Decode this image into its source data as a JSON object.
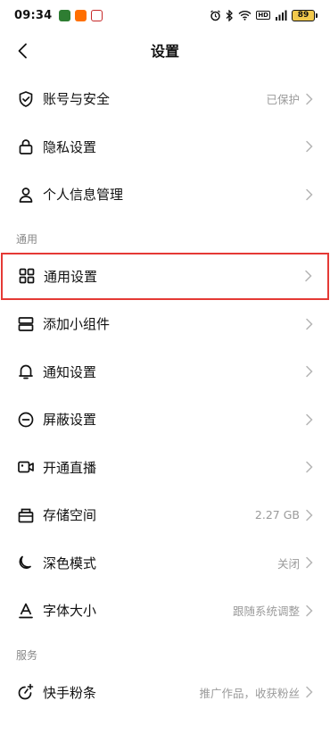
{
  "status_bar": {
    "time": "09:34",
    "hd_label": "HD",
    "battery": "89"
  },
  "header": {
    "title": "设置"
  },
  "account_section": {
    "items": [
      {
        "label": "账号与安全",
        "value": "已保护",
        "icon": "shield-check-icon"
      },
      {
        "label": "隐私设置",
        "value": "",
        "icon": "lock-icon"
      },
      {
        "label": "个人信息管理",
        "value": "",
        "icon": "person-icon"
      }
    ]
  },
  "general_section": {
    "title": "通用",
    "items": [
      {
        "label": "通用设置",
        "value": "",
        "icon": "grid-icon"
      },
      {
        "label": "添加小组件",
        "value": "",
        "icon": "widget-icon"
      },
      {
        "label": "通知设置",
        "value": "",
        "icon": "bell-icon"
      },
      {
        "label": "屏蔽设置",
        "value": "",
        "icon": "block-icon"
      },
      {
        "label": "开通直播",
        "value": "",
        "icon": "live-camera-icon"
      },
      {
        "label": "存储空间",
        "value": "2.27 GB",
        "icon": "storage-box-icon"
      },
      {
        "label": "深色模式",
        "value": "关闭",
        "icon": "moon-icon"
      },
      {
        "label": "字体大小",
        "value": "跟随系统调整",
        "icon": "font-size-icon"
      }
    ]
  },
  "service_section": {
    "title": "服务",
    "items": [
      {
        "label": "快手粉条",
        "value": "推广作品，收获粉丝",
        "icon": "promote-icon"
      }
    ]
  },
  "colors": {
    "highlight_border": "#e53935",
    "secondary_text": "#9a9a9a"
  }
}
